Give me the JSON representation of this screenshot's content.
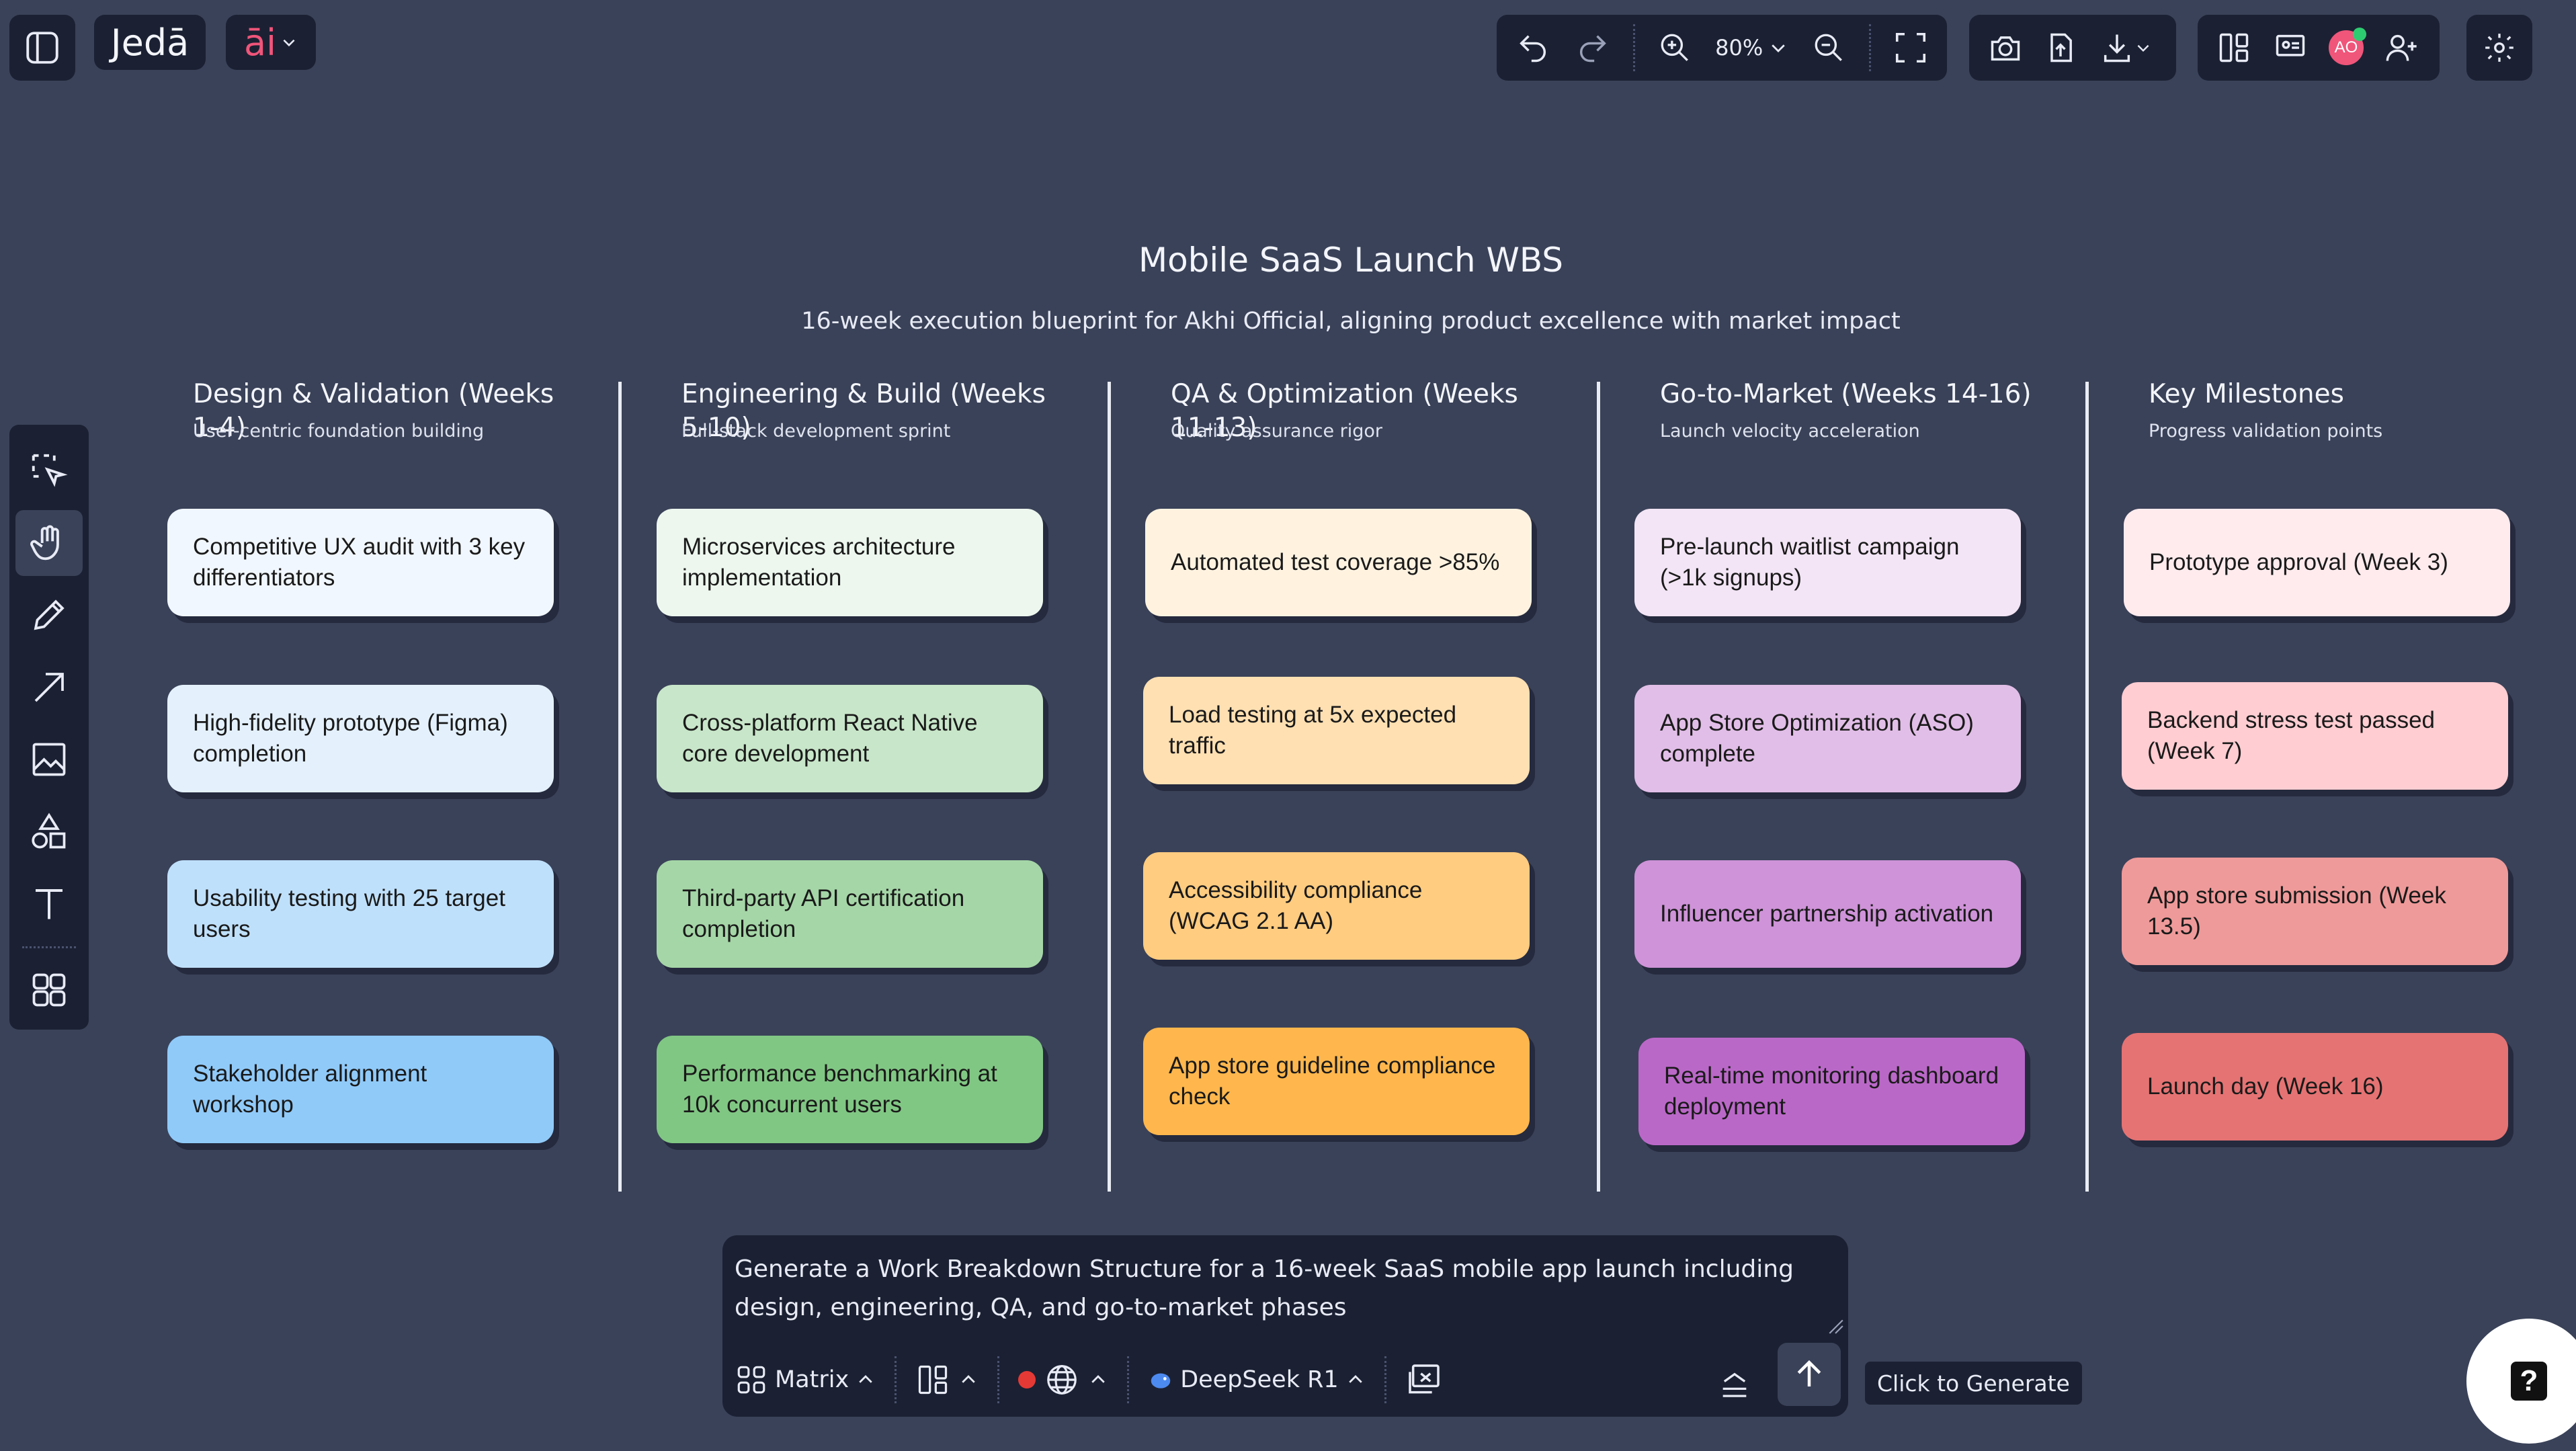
{
  "app": {
    "logo_text": "Jedā",
    "ai_label": "āi"
  },
  "toolbar": {
    "zoom_level": "80%",
    "avatar_initials": "AO"
  },
  "canvas": {
    "title": "Mobile SaaS Launch WBS",
    "subtitle": "16-week execution blueprint for Akhi Official, aligning product excellence with market impact",
    "columns": [
      {
        "heading": "Design & Validation (Weeks 1-4)",
        "subheading": "User-centric foundation building",
        "cards": [
          {
            "text": "Competitive UX audit with 3 key differentiators",
            "color": "#f1f7fe"
          },
          {
            "text": "High-fidelity prototype (Figma) completion",
            "color": "#e4f1fd"
          },
          {
            "text": "Usability testing with 25 target users",
            "color": "#bfe0fb"
          },
          {
            "text": "Stakeholder alignment workshop",
            "color": "#90caf9"
          }
        ]
      },
      {
        "heading": "Engineering & Build (Weeks 5-10)",
        "subheading": "Full-stack development sprint",
        "cards": [
          {
            "text": "Microservices architecture implementation",
            "color": "#edf7ee"
          },
          {
            "text": "Cross-platform React Native core development",
            "color": "#c8e6c9"
          },
          {
            "text": "Third-party API certification completion",
            "color": "#a5d6a7"
          },
          {
            "text": "Performance benchmarking at 10k concurrent users",
            "color": "#81c784"
          }
        ]
      },
      {
        "heading": "QA & Optimization (Weeks 11-13)",
        "subheading": "Quality assurance rigor",
        "cards": [
          {
            "text": "Automated test coverage >85%",
            "color": "#fff3e0"
          },
          {
            "text": "Load testing at 5x expected traffic",
            "color": "#ffe0b2"
          },
          {
            "text": "Accessibility compliance (WCAG 2.1 AA)",
            "color": "#ffcc80"
          },
          {
            "text": "App store guideline compliance check",
            "color": "#ffb74d"
          }
        ]
      },
      {
        "heading": "Go-to-Market (Weeks 14-16)",
        "subheading": "Launch velocity acceleration",
        "cards": [
          {
            "text": "Pre-launch waitlist campaign (>1k signups)",
            "color": "#f3e5f5"
          },
          {
            "text": "App Store Optimization (ASO) complete",
            "color": "#e1bee7"
          },
          {
            "text": "Influencer partnership activation",
            "color": "#ce93d8"
          },
          {
            "text": "Real-time monitoring dashboard deployment",
            "color": "#ba68c8"
          }
        ]
      },
      {
        "heading": "Key Milestones",
        "subheading": "Progress validation points",
        "cards": [
          {
            "text": "Prototype approval (Week 3)",
            "color": "#ffebee"
          },
          {
            "text": "Backend stress test passed (Week 7)",
            "color": "#ffcdd2"
          },
          {
            "text": "App store submission (Week 13.5)",
            "color": "#ef9a9a"
          },
          {
            "text": "Launch day (Week 16)",
            "color": "#e57373"
          }
        ]
      }
    ]
  },
  "prompt": {
    "text": "Generate a Work Breakdown Structure for a 16-week SaaS mobile app launch including design, engineering, QA, and go-to-market phases",
    "layout_label": "Matrix",
    "model_label": "DeepSeek R1",
    "generate_tooltip": "Click to Generate"
  }
}
